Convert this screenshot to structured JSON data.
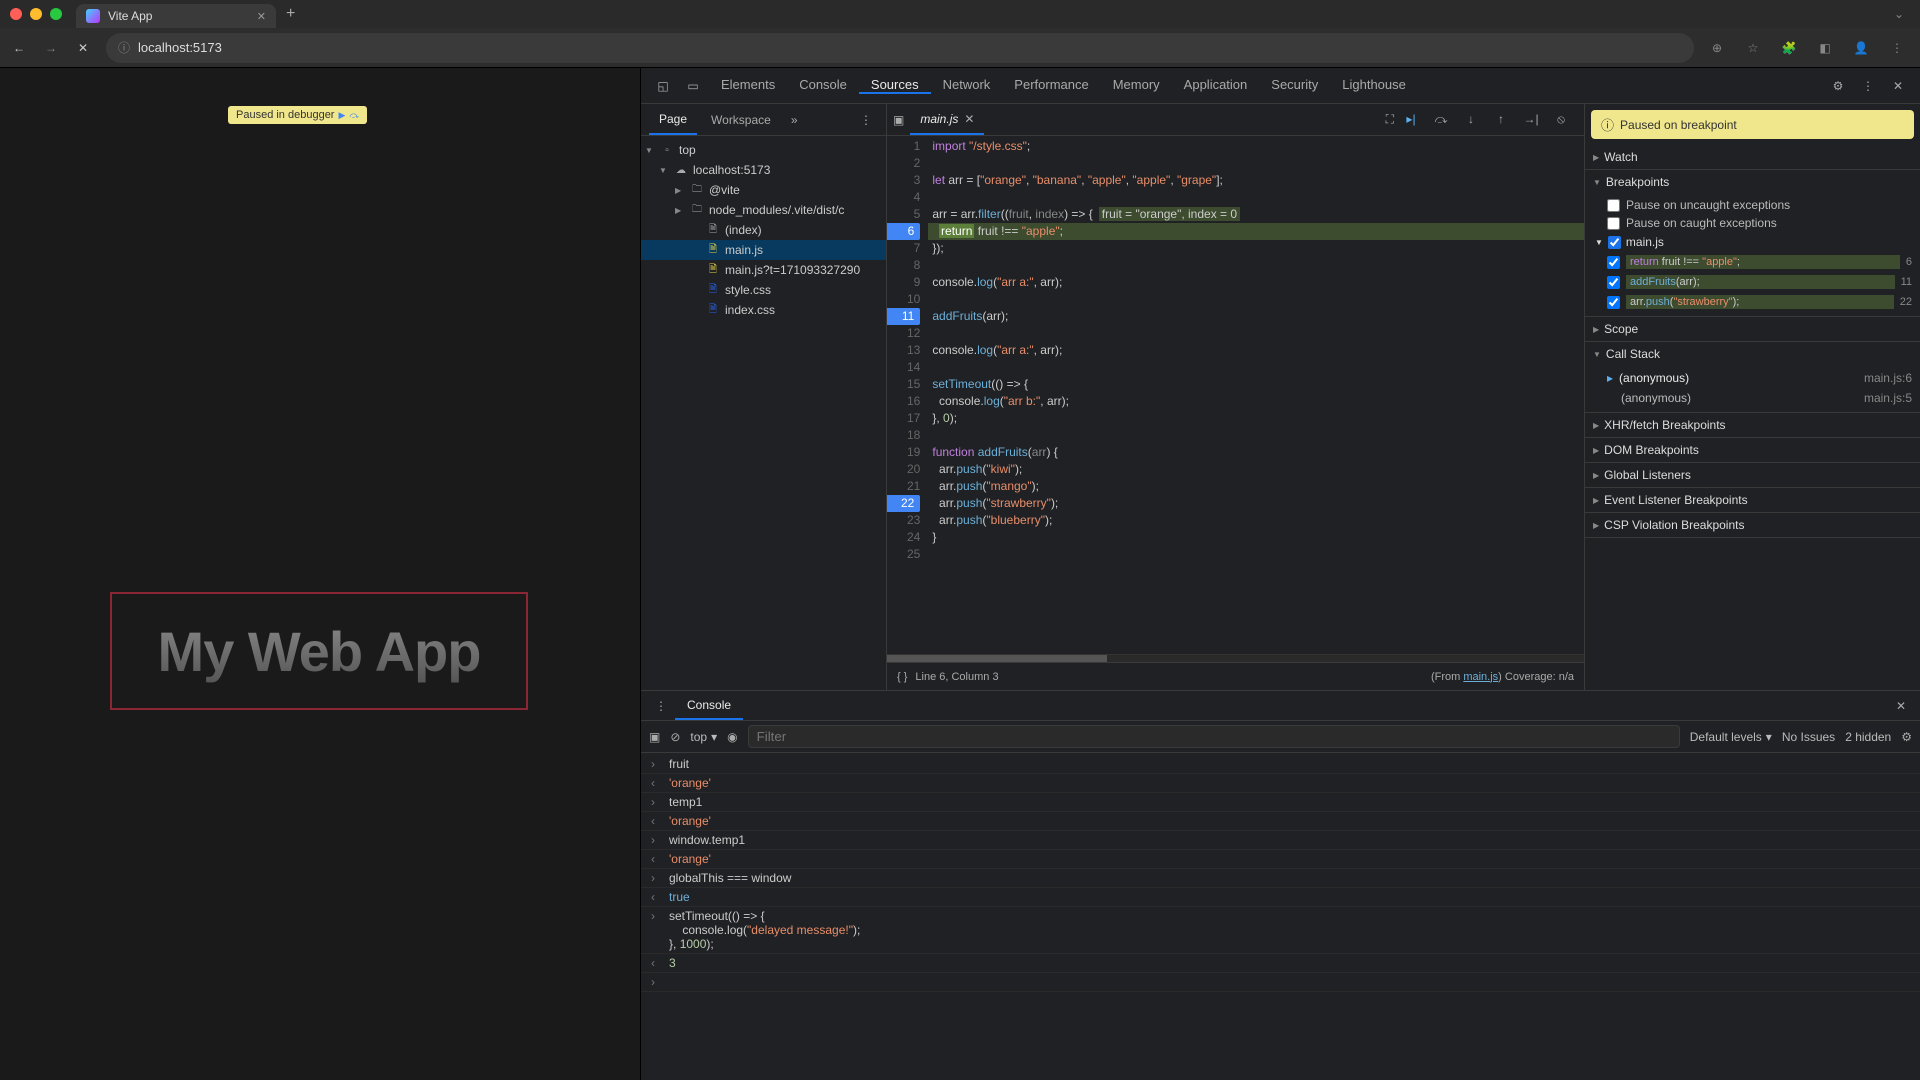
{
  "browser": {
    "tab_title": "Vite App",
    "url": "localhost:5173"
  },
  "page_overlay": {
    "paused_label": "Paused in debugger",
    "app_heading": "My Web App"
  },
  "devtools": {
    "tabs": [
      "Elements",
      "Console",
      "Sources",
      "Network",
      "Performance",
      "Memory",
      "Application",
      "Security",
      "Lighthouse"
    ],
    "active_tab": "Sources"
  },
  "navigator": {
    "tabs": {
      "page": "Page",
      "workspace": "Workspace"
    },
    "tree": {
      "top": "top",
      "host": "localhost:5173",
      "vite_folder": "@vite",
      "nm_folder": "node_modules/.vite/dist/c",
      "files": {
        "index": "(index)",
        "main": "main.js",
        "main_ts": "main.js?t=171093327290",
        "style": "style.css",
        "index_css": "index.css"
      }
    }
  },
  "editor": {
    "open_file": "main.js",
    "status_line": "Line 6, Column 3",
    "from_label": "(From ",
    "from_link": "main.js",
    "coverage": ") Coverage: n/a",
    "lines": [
      {
        "n": 1,
        "html": "<span class='kw'>import</span> <span class='str'>\"/style.css\"</span>;"
      },
      {
        "n": 2,
        "html": ""
      },
      {
        "n": 3,
        "html": "<span class='kw'>let</span> arr = [<span class='str'>\"orange\"</span>, <span class='str'>\"banana\"</span>, <span class='str'>\"apple\"</span>, <span class='str'>\"apple\"</span>, <span class='str'>\"grape\"</span>];"
      },
      {
        "n": 4,
        "html": ""
      },
      {
        "n": 5,
        "html": "arr = arr.<span class='fn'>filter</span>((<span class='prm'>fruit</span>, <span class='prm'>index</span>) =&gt; {<span class='inl'>fruit = \"orange\", index = 0</span>"
      },
      {
        "n": 6,
        "bp": true,
        "paused": true,
        "html": "  <span class='kw' style='background:#5c8039;color:#fff;padding:0 2px'>return</span> fruit !== <span class='str'>\"apple\"</span>;"
      },
      {
        "n": 7,
        "html": "});"
      },
      {
        "n": 8,
        "html": ""
      },
      {
        "n": 9,
        "html": "console.<span class='fn'>log</span>(<span class='str'>\"arr a:\"</span>, arr);"
      },
      {
        "n": 10,
        "html": ""
      },
      {
        "n": 11,
        "bp": true,
        "html": "<span class='fn'>addFruits</span>(arr);"
      },
      {
        "n": 12,
        "html": ""
      },
      {
        "n": 13,
        "html": "console.<span class='fn'>log</span>(<span class='str'>\"arr a:\"</span>, arr);"
      },
      {
        "n": 14,
        "html": ""
      },
      {
        "n": 15,
        "html": "<span class='fn'>setTimeout</span>(() =&gt; {"
      },
      {
        "n": 16,
        "html": "  console.<span class='fn'>log</span>(<span class='str'>\"arr b:\"</span>, arr);"
      },
      {
        "n": 17,
        "html": "}, <span class='num'>0</span>);"
      },
      {
        "n": 18,
        "html": ""
      },
      {
        "n": 19,
        "html": "<span class='kw'>function</span> <span class='fn'>addFruits</span>(<span class='prm'>arr</span>) {"
      },
      {
        "n": 20,
        "html": "  arr.<span class='fn'>push</span>(<span class='str'>\"kiwi\"</span>);"
      },
      {
        "n": 21,
        "html": "  arr.<span class='fn'>push</span>(<span class='str'>\"mango\"</span>);"
      },
      {
        "n": 22,
        "bp": true,
        "html": "  arr.<span class='fn'>push</span>(<span class='str'>\"strawberry\"</span>);"
      },
      {
        "n": 23,
        "html": "  arr.<span class='fn'>push</span>(<span class='str'>\"blueberry\"</span>);"
      },
      {
        "n": 24,
        "html": "}"
      },
      {
        "n": 25,
        "html": ""
      }
    ]
  },
  "debugger": {
    "banner": "Paused on breakpoint",
    "sections": {
      "watch": "Watch",
      "breakpoints": "Breakpoints",
      "scope": "Scope",
      "callstack": "Call Stack",
      "xhr": "XHR/fetch Breakpoints",
      "dom": "DOM Breakpoints",
      "global": "Global Listeners",
      "event": "Event Listener Breakpoints",
      "csp": "CSP Violation Breakpoints"
    },
    "pause_uncaught": "Pause on uncaught exceptions",
    "pause_caught": "Pause on caught exceptions",
    "bp_file": "main.js",
    "breakpoint_list": [
      {
        "code": "<span class='kw'>return</span> fruit !== <span class='str'>\"apple\"</span>;",
        "line": "6"
      },
      {
        "code": "<span class='fn'>addFruits</span>(arr);",
        "line": "11"
      },
      {
        "code": "arr.<span class='fn'>push</span>(<span class='str'>\"strawberry\"</span>);",
        "line": "22"
      }
    ],
    "callstack": [
      {
        "name": "(anonymous)",
        "loc": "main.js:6",
        "active": true
      },
      {
        "name": "(anonymous)",
        "loc": "main.js:5",
        "active": false
      }
    ]
  },
  "console": {
    "tab": "Console",
    "context": "top",
    "filter_placeholder": "Filter",
    "levels": "Default levels",
    "issues": "No Issues",
    "hidden": "2 hidden",
    "rows": [
      {
        "mk": ">",
        "html": "fruit"
      },
      {
        "mk": "<",
        "html": "<span class='cstr'>'orange'</span>"
      },
      {
        "mk": ">",
        "html": "temp1"
      },
      {
        "mk": "<",
        "html": "<span class='cstr'>'orange'</span>"
      },
      {
        "mk": ">",
        "html": "window.<span class='ckey'>temp1</span>"
      },
      {
        "mk": "<",
        "html": "<span class='cstr'>'orange'</span>"
      },
      {
        "mk": ">",
        "html": "globalThis === window"
      },
      {
        "mk": "<",
        "html": "<span class='cbool'>true</span>"
      },
      {
        "mk": ">",
        "html": "setTimeout(() => {\n    console.log(<span class='cstr'>\"delayed message!\"</span>);\n}, <span class='cnum'>1000</span>);"
      },
      {
        "mk": "<",
        "html": "<span class='cnum'>3</span>"
      },
      {
        "mk": ">",
        "html": ""
      }
    ]
  }
}
